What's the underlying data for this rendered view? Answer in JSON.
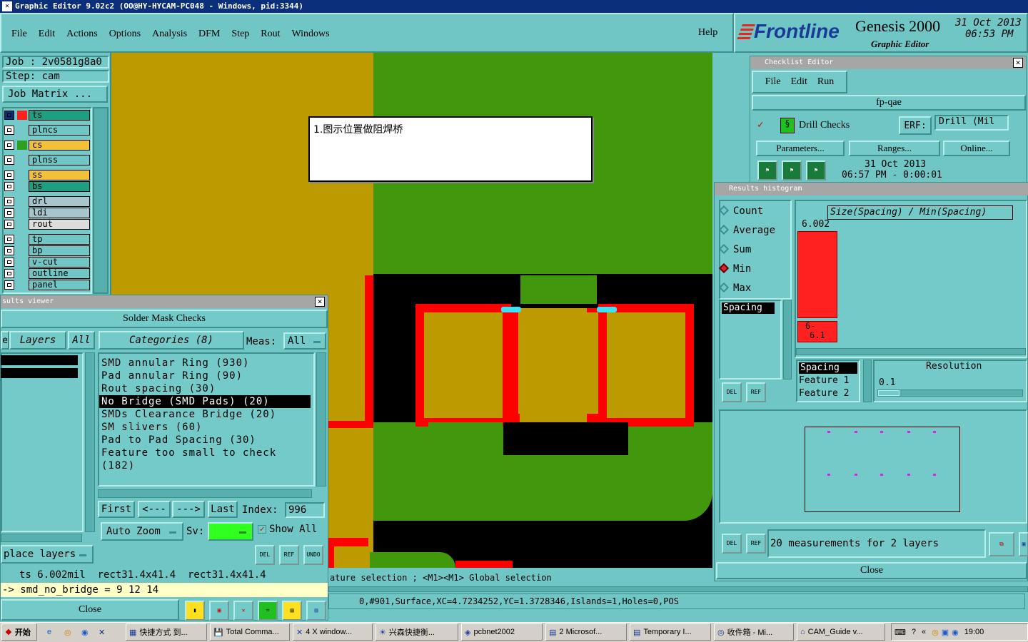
{
  "window_title": "Graphic Editor 9.02c2 (OO@HY-HYCAM-PC048 - Windows, pid:3344)",
  "menu": [
    "File",
    "Edit",
    "Actions",
    "Options",
    "Analysis",
    "DFM",
    "Step",
    "Rout",
    "Windows"
  ],
  "help": "Help",
  "brand": {
    "logo": "Frontline",
    "product": "Genesis 2000",
    "sub": "Graphic Editor",
    "date": "31 Oct 2013",
    "time": "06:53 PM"
  },
  "job": {
    "job": "Job : 2v0581g8a0",
    "step": "Step: cam",
    "matrix": "Job Matrix ..."
  },
  "layers": [
    {
      "name": "ts",
      "color": "#1e9e82",
      "box": "#ff2020"
    },
    {
      "name": "plncs",
      "color": "#6fc6c4"
    },
    {
      "name": "cs",
      "color": "#f3c03a",
      "box": "#2fa01e"
    },
    {
      "name": "plnss",
      "color": "#6fc6c4"
    },
    {
      "name": "ss",
      "color": "#f3c03a"
    },
    {
      "name": "bs",
      "color": "#1e9e82"
    },
    {
      "name": "drl",
      "color": "#a8c4cc"
    },
    {
      "name": "ldi",
      "color": "#a8c4cc"
    },
    {
      "name": "rout",
      "color": "#dcdcdc"
    },
    {
      "name": "tp",
      "color": "#6fc6c4"
    },
    {
      "name": "bp",
      "color": "#6fc6c4"
    },
    {
      "name": "v-cut",
      "color": "#6fc6c4"
    },
    {
      "name": "outline",
      "color": "#6fc6c4"
    },
    {
      "name": "panel",
      "color": "#6fc6c4"
    }
  ],
  "note": "1.图示位置做阻焊桥",
  "results_viewer": {
    "title": "sults viewer",
    "header": "Solder Mask Checks",
    "tab_layers": "Layers",
    "tab_all": "All",
    "categories_label": "Categories (8)",
    "meas_label": "Meas:",
    "meas_value": "All",
    "categories": [
      "SMD annular Ring (930)",
      "Pad annular Ring (90)",
      "Rout spacing (30)",
      "No Bridge (SMD Pads) (20)",
      "SMDs Clearance Bridge (20)",
      "SM slivers (60)",
      "Pad to Pad Spacing (30)",
      "Feature too small to check (182)"
    ],
    "selected_index": 3,
    "first": "First",
    "prev": "<---",
    "next": "--->",
    "last": "Last",
    "index_label": "Index:",
    "index_value": "996",
    "auto_zoom": "Auto Zoom",
    "sv": "Sv:",
    "show_all": "Show All",
    "place_layers": "place layers",
    "del": "DEL",
    "ref": "REF",
    "undo": "UNDO",
    "info_line": "ts 6.002mil  rect31.4x41.4  rect31.4x41.4",
    "cmd_line": "-> smd_no_bridge = 9 12 14",
    "close": "Close"
  },
  "checklist": {
    "title": "Checklist Editor",
    "menu": [
      "File",
      "Edit",
      "Run"
    ],
    "name": "fp-qae",
    "drill_checks": "Drill Checks",
    "erf": "ERF:",
    "erf_value": "Drill (Mil",
    "parameters": "Parameters...",
    "ranges": "Ranges...",
    "online": "Online...",
    "date": "31 Oct 2013",
    "time": "06:57 PM - 0:00:01"
  },
  "histogram": {
    "title": "Results histogram",
    "options": [
      "Count",
      "Average",
      "Sum",
      "Min",
      "Max"
    ],
    "selected": "Min",
    "formula": "Size(Spacing) / Min(Spacing)",
    "bar_value": "6.002",
    "bar_label_1": "6-",
    "bar_label_2": "6.1",
    "list_item": "Spacing",
    "rows": [
      "Spacing",
      "Feature 1",
      "Feature 2"
    ],
    "resolution_label": "Resolution",
    "resolution_value": "0.1",
    "measurements": "20 measurements for 2 layers",
    "close": "Close"
  },
  "status": {
    "selection": "ature selection ; <M1><M1> Global selection",
    "coords": "0,#901,Surface,XC=4.7234252,YC=1.3728346,Islands=1,Holes=0,POS"
  },
  "taskbar": {
    "start": "开始",
    "items": [
      "快捷方式 到...",
      "Total Comma...",
      "4 X window...",
      "兴森快捷衡...",
      "pcbnet2002",
      "2 Microsof...",
      "Temporary I...",
      "收件箱 - Mi...",
      "CAM_Guide v..."
    ],
    "clock": "19:00"
  }
}
